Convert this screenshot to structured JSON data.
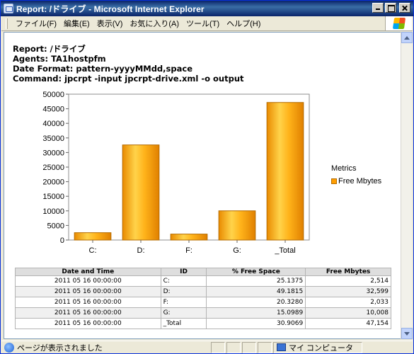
{
  "window": {
    "title": "Report: /ドライブ - Microsoft Internet Explorer",
    "menu": [
      "ファイル(F)",
      "編集(E)",
      "表示(V)",
      "お気に入り(A)",
      "ツール(T)",
      "ヘルプ(H)"
    ]
  },
  "report": {
    "title_line": "Report: /ドライブ",
    "agents_line": "Agents: TA1hostpfm",
    "date_format_line": "Date Format: pattern-yyyyMMdd,space",
    "command_line": "Command: jpcrpt -input jpcrpt-drive.xml -o output"
  },
  "chart_data": {
    "type": "bar",
    "categories": [
      "C:",
      "D:",
      "F:",
      "G:",
      "_Total"
    ],
    "series": [
      {
        "name": "Free Mbytes",
        "values": [
          2514,
          32599,
          2033,
          10008,
          47154
        ]
      }
    ],
    "ylim": [
      0,
      50000
    ],
    "yticks": [
      0,
      5000,
      10000,
      15000,
      20000,
      25000,
      30000,
      35000,
      40000,
      45000,
      50000
    ],
    "legend_title": "Metrics",
    "legend_position": "right",
    "grid": false,
    "colors": {
      "bar": "#ff9e00",
      "bar_edge": "#b36b00"
    }
  },
  "table": {
    "headers": [
      "Date and Time",
      "ID",
      "% Free Space",
      "Free Mbytes"
    ],
    "rows": [
      [
        "2011 05 16 00:00:00",
        "C:",
        "25.1375",
        "2,514"
      ],
      [
        "2011 05 16 00:00:00",
        "D:",
        "49.1815",
        "32,599"
      ],
      [
        "2011 05 16 00:00:00",
        "F:",
        "20.3280",
        "2,033"
      ],
      [
        "2011 05 16 00:00:00",
        "G:",
        "15.0989",
        "10,008"
      ],
      [
        "2011 05 16 00:00:00",
        "_Total",
        "30.9069",
        "47,154"
      ]
    ]
  },
  "status": {
    "text": "ページが表示されました",
    "zone": "マイ コンピュータ"
  }
}
